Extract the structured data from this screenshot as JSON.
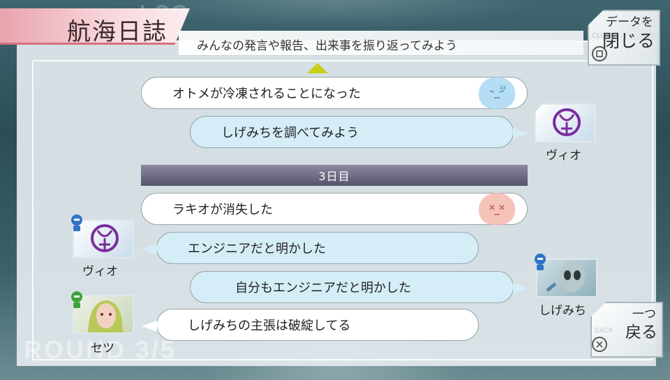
{
  "screen": {
    "title": "航海日誌",
    "subtitle": "みんなの発言や報告、出来事を振り返ってみよう",
    "watermark_top": "LOG",
    "watermark_bottom": "ROUND 3/5"
  },
  "close_button": {
    "line1": "データを",
    "line2": "閉じる",
    "icon": "square-button-icon",
    "ghost": "CLOSE"
  },
  "back_button": {
    "line1": "一つ",
    "line2": "戻る",
    "icon": "cross-button-icon",
    "ghost": "BACK"
  },
  "colors": {
    "title_tab": "#f2b8c0",
    "day_bar": "#6e6c82",
    "scroll_arrow": "#c8cf18",
    "report_bubble": "#ffffff",
    "speech_bubble": "#d4edf6"
  },
  "log": {
    "scroll_icon": "triangle-up-icon",
    "entries": [
      {
        "kind": "event",
        "text": "オトメが冷凍されることになった",
        "icon": "frozen-head-icon"
      },
      {
        "kind": "speech",
        "text": "しげみちを調べてみよう",
        "speaker": "ヴィオ"
      },
      {
        "kind": "day",
        "text": "3日目"
      },
      {
        "kind": "event",
        "text": "ラキオが消失した",
        "icon": "vanished-head-icon"
      },
      {
        "kind": "speech",
        "text": "エンジニアだと明かした",
        "speaker": "ヴィオ",
        "role_icon": "engineer-icon"
      },
      {
        "kind": "speech",
        "text": "自分もエンジニアだと明かした",
        "speaker": "しげみち",
        "role_icon": "engineer-icon"
      },
      {
        "kind": "speech",
        "text": "しげみちの主張は破綻してる",
        "speaker": "セツ",
        "role_icon": "guardian-icon"
      }
    ]
  }
}
